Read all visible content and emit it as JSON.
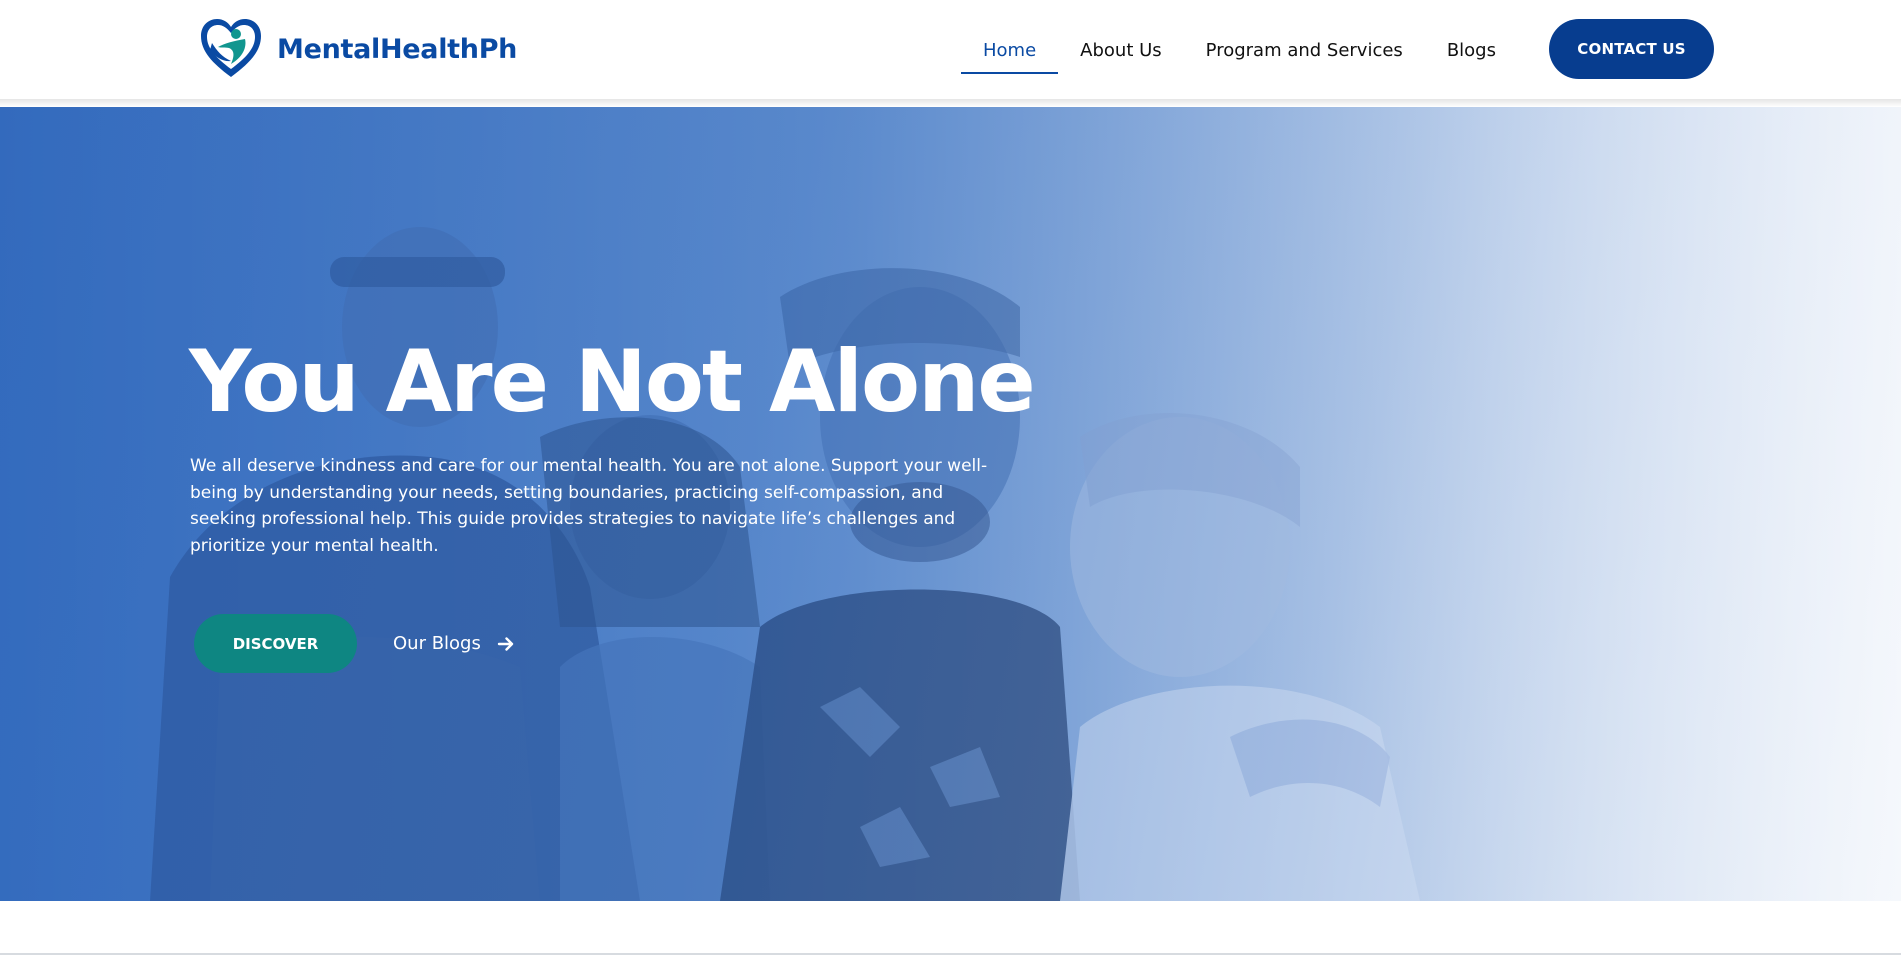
{
  "brand": {
    "name": "MentalHealthPh",
    "logo_icon": "heart-person-logo-icon",
    "colors": {
      "primary": "#0a4aa3",
      "accent": "#11968f"
    }
  },
  "nav": {
    "items": [
      {
        "label": "Home",
        "active": true
      },
      {
        "label": "About Us",
        "active": false
      },
      {
        "label": "Program and Services",
        "active": false
      },
      {
        "label": "Blogs",
        "active": false
      }
    ],
    "contact_label": "CONTACT US",
    "contact_color": "#073d8f"
  },
  "hero": {
    "title": "You Are Not Alone",
    "text": "We all deserve kindness and care for our mental health. You are not alone. Support your well-being by understanding your needs, setting boundaries, practicing self-compassion, and seeking professional help. This guide provides strategies to navigate life’s challenges and prioritize your mental health.",
    "discover_label": "DISCOVER",
    "discover_color": "#0e8682",
    "blogs_label": "Our Blogs",
    "blogs_icon": "arrow-right-icon",
    "overlay_colors": [
      "#3f77c6",
      "#f3f6fb"
    ]
  }
}
